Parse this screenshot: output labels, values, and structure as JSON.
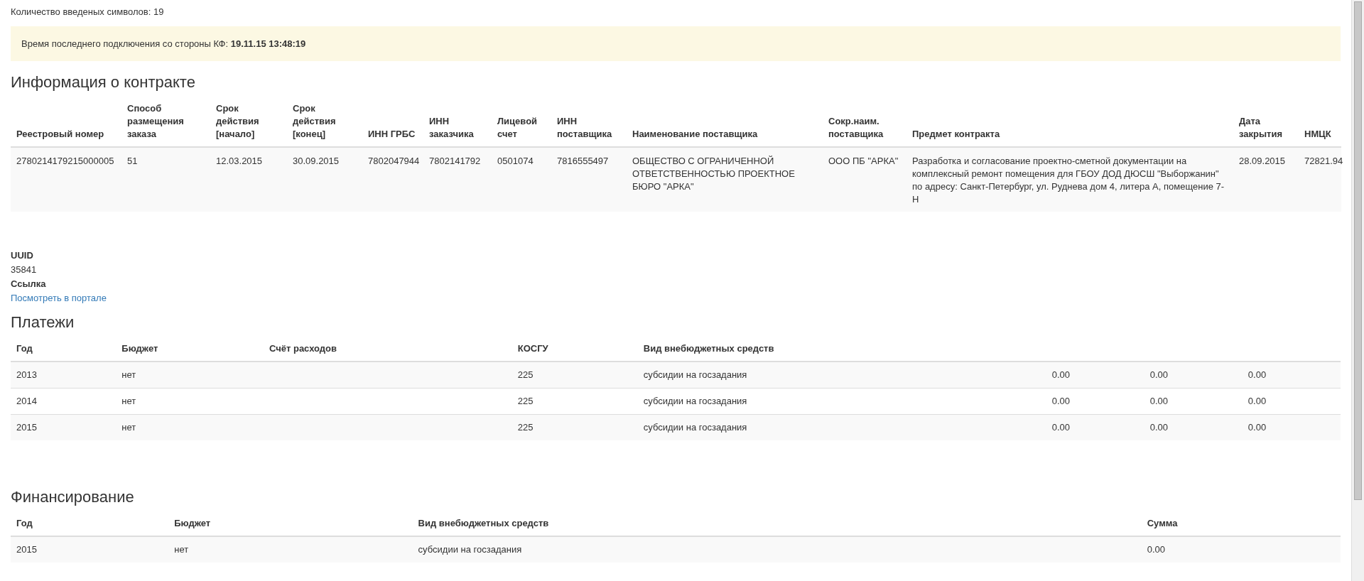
{
  "char_count": "Количество введеных символов: 19",
  "alert": "Время последнего подключения со стороны КФ: **19.11.15 13:48:19**",
  "contract": {
    "title": "Информация о контракте",
    "columns": [
      "Реестровый номер",
      "Способ размещения заказа",
      "Срок действия [начало]",
      "Срок действия [конец]",
      "ИНН ГРБС",
      "ИНН заказчика",
      "Лицевой счет",
      "ИНН поставщика",
      "Наименование поставщика",
      "Сокр.наим. поставщика",
      "Предмет контракта",
      "Дата закрытия",
      "НМЦК"
    ],
    "rows": [
      [
        "2780214179215000005",
        "51",
        "12.03.2015",
        "30.09.2015",
        "7802047944",
        "7802141792",
        "0501074",
        "7816555497",
        "ОБЩЕСТВО С ОГРАНИЧЕННОЙ ОТВЕТСТВЕННОСТЬЮ ПРОЕКТНОЕ БЮРО \"АРКА\"",
        "ООО ПБ \"АРКА\"",
        "Разработка и согласование проектно-сметной документации на комплексный ремонт помещения для ГБОУ ДОД ДЮСШ \"Выборжанин\" по адресу: Санкт-Петербург, ул. Руднева дом 4, литера А, помещение 7-Н",
        "28.09.2015",
        "72821.94"
      ]
    ]
  },
  "details": [
    {
      "label": "UUID",
      "value": "35841",
      "kind": "text"
    },
    {
      "label": "Ссылка",
      "value": "Посмотреть в портале",
      "kind": "link"
    }
  ],
  "payments": {
    "title": "Платежи",
    "columns": [
      "Год",
      "Бюджет",
      "Счёт расходов",
      "КОСГУ",
      "Вид внебюджетных средств"
    ],
    "rows": [
      [
        "2013",
        "нет",
        "",
        "225",
        "субсидии на госзадания",
        "0.00",
        "0.00",
        "0.00"
      ],
      [
        "2014",
        "нет",
        "",
        "225",
        "субсидии на госзадания",
        "0.00",
        "0.00",
        "0.00"
      ],
      [
        "2015",
        "нет",
        "",
        "225",
        "субсидии на госзадания",
        "0.00",
        "0.00",
        "0.00"
      ]
    ]
  },
  "financing": {
    "title": "Финансирование",
    "columns": [
      "Год",
      "Бюджет",
      "Вид внебюджетных средств",
      "Сумма"
    ],
    "rows": [
      [
        "2015",
        "нет",
        "субсидии на госзадания",
        "0.00"
      ]
    ]
  }
}
